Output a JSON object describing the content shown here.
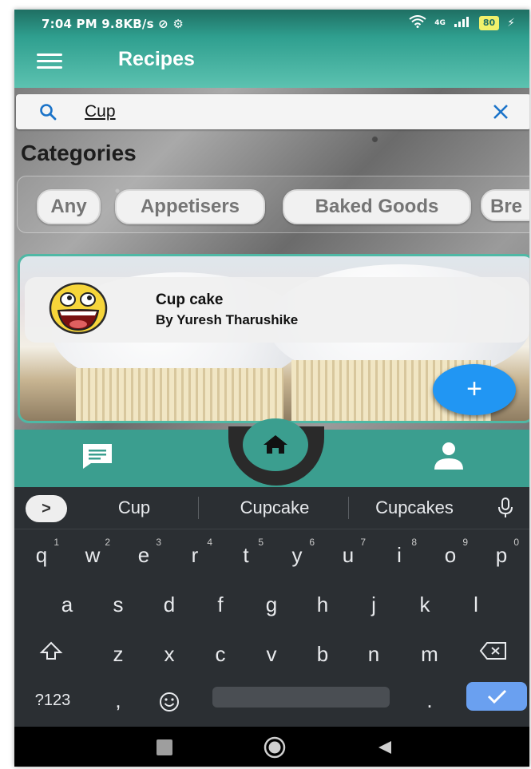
{
  "status": {
    "time": "7:04 PM",
    "speed": "9.8KB/s",
    "network": "4G",
    "battery": "80"
  },
  "appbar": {
    "title": "Recipes"
  },
  "search": {
    "value": "Cup"
  },
  "categories": {
    "title": "Categories",
    "chips": [
      "Any",
      "Appetisers",
      "Baked Goods",
      "Bre"
    ]
  },
  "recipe": {
    "name": "Cup cake",
    "author": "By Yuresh Tharushike"
  },
  "fab": {
    "label": "+"
  },
  "keyboard": {
    "expand": ">",
    "suggestions": [
      "Cup",
      "Cupcake",
      "Cupcakes"
    ],
    "row1": [
      {
        "k": "q",
        "n": "1"
      },
      {
        "k": "w",
        "n": "2"
      },
      {
        "k": "e",
        "n": "3"
      },
      {
        "k": "r",
        "n": "4"
      },
      {
        "k": "t",
        "n": "5"
      },
      {
        "k": "y",
        "n": "6"
      },
      {
        "k": "u",
        "n": "7"
      },
      {
        "k": "i",
        "n": "8"
      },
      {
        "k": "o",
        "n": "9"
      },
      {
        "k": "p",
        "n": "0"
      }
    ],
    "row2": [
      "a",
      "s",
      "d",
      "f",
      "g",
      "h",
      "j",
      "k",
      "l"
    ],
    "row3": [
      "z",
      "x",
      "c",
      "v",
      "b",
      "n",
      "m"
    ],
    "symbols": "?123",
    "comma": ",",
    "period": "."
  },
  "colors": {
    "teal": "#3b9e8f",
    "fab_blue": "#2196f3",
    "enter_blue": "#6aa0f0"
  }
}
